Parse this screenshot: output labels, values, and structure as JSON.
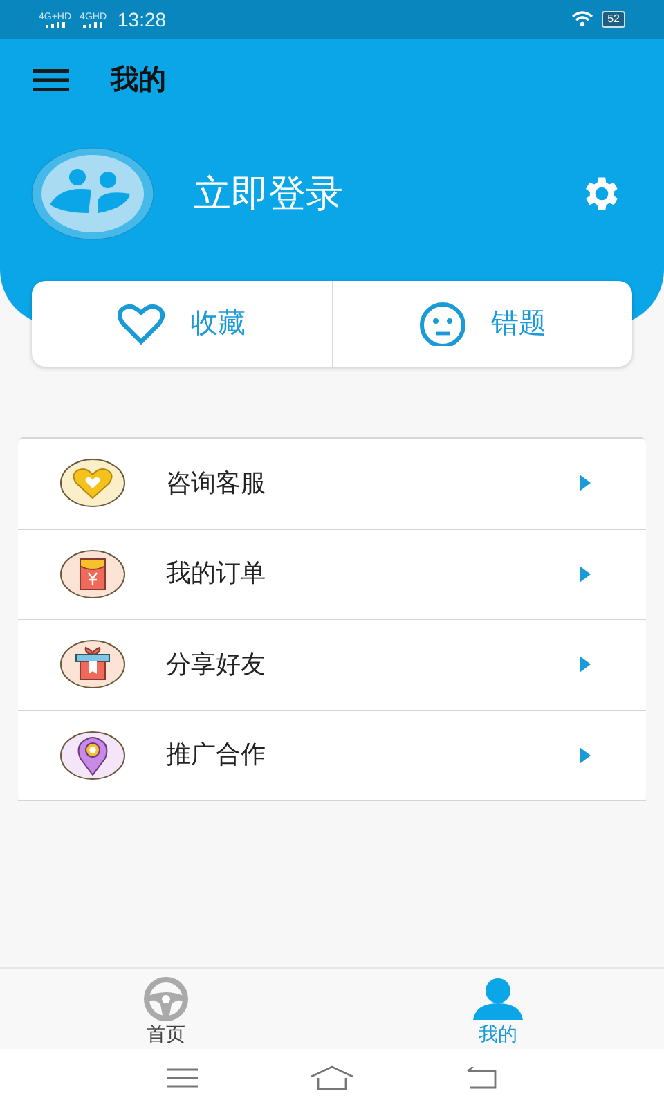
{
  "status_bar": {
    "networks": [
      "4G+HD",
      "4GHD"
    ],
    "time": "13:28",
    "battery": "52"
  },
  "header": {
    "title": "我的"
  },
  "profile": {
    "login": "立即登录"
  },
  "quick_actions": [
    {
      "kind": "heart",
      "label": "收藏"
    },
    {
      "kind": "face",
      "label": "错题"
    }
  ],
  "menu": [
    {
      "kind": "heart",
      "label": "咨询客服"
    },
    {
      "kind": "envelope",
      "label": "我的订单"
    },
    {
      "kind": "gift",
      "label": "分享好友"
    },
    {
      "kind": "pin",
      "label": "推广合作"
    }
  ],
  "tabs": [
    {
      "kind": "wheel",
      "label": "首页",
      "selected": false
    },
    {
      "kind": "person",
      "label": "我的",
      "selected": true
    }
  ]
}
